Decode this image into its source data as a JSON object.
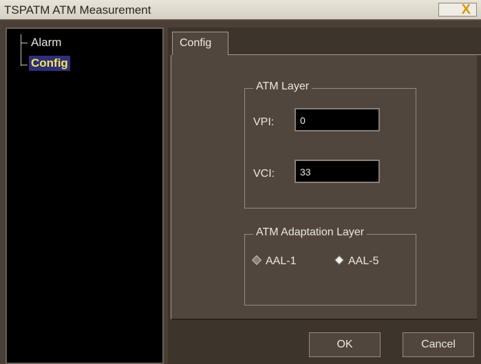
{
  "window": {
    "title": "TSPATM ATM Measurement",
    "close_glyph": "X"
  },
  "tree": {
    "items": [
      {
        "label": "Alarm"
      },
      {
        "label": "Config"
      }
    ]
  },
  "tabs": [
    {
      "label": "Config"
    }
  ],
  "atm_layer": {
    "legend": "ATM Layer",
    "vpi_label": "VPI:",
    "vpi_value": "0",
    "vci_label": "VCI:",
    "vci_value": "33"
  },
  "aal": {
    "legend": "ATM Adaptation Layer",
    "options": [
      {
        "label": "AAL-1",
        "selected": false
      },
      {
        "label": "AAL-5",
        "selected": true
      }
    ]
  },
  "buttons": {
    "ok": "OK",
    "cancel": "Cancel"
  },
  "colors": {
    "selected_tree_bg": "#2f2f7a",
    "selected_tree_text": "#f2e65a",
    "close_x": "#d79a00"
  }
}
